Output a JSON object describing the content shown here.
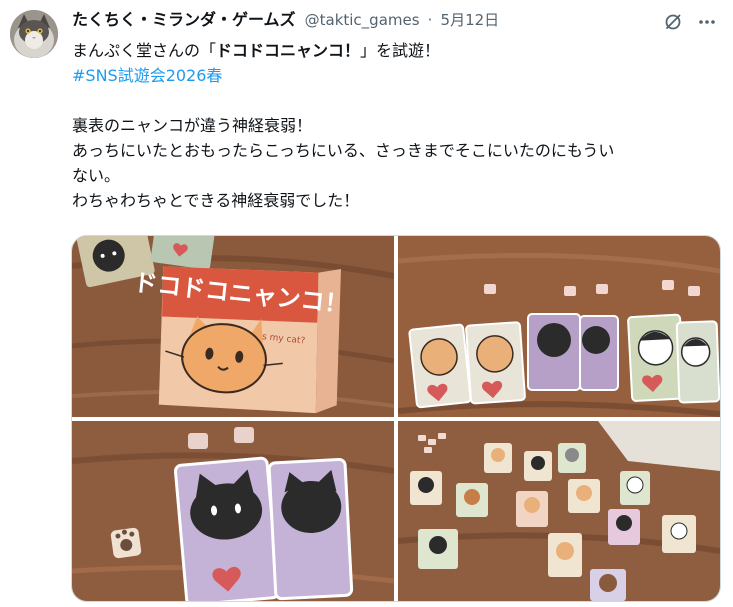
{
  "tweet": {
    "author_name": "たくちく・ミランダ・ゲームズ",
    "handle": "@taktic_games",
    "separator": "·",
    "date": "5月12日",
    "line1_prefix": "まんぷく堂さんの「",
    "line1_bold": "ドコドコニャンコ！",
    "line1_suffix": "」を試遊！",
    "hashtag": "#SNS試遊会2026春",
    "line3": "裏表のニャンコが違う神経衰弱！",
    "line4": "あっちにいたとおもったらこっちにいる、さっきまでそこにいたのにもうい",
    "line5": "ない。",
    "line6": "わちゃわちゃとできる神経衰弱でした！"
  },
  "photos": {
    "box_title": "ドコドコニャンコ！",
    "box_subtitle": "Where is my cat?"
  },
  "icons": {
    "avatar": "cat-avatar",
    "grok": "grok-icon",
    "more": "more-icon"
  },
  "colors": {
    "hashtag": "#1d9bf0",
    "secondary": "#536471",
    "table_wood": "#8a5a3c",
    "box_red": "#d9573f"
  }
}
